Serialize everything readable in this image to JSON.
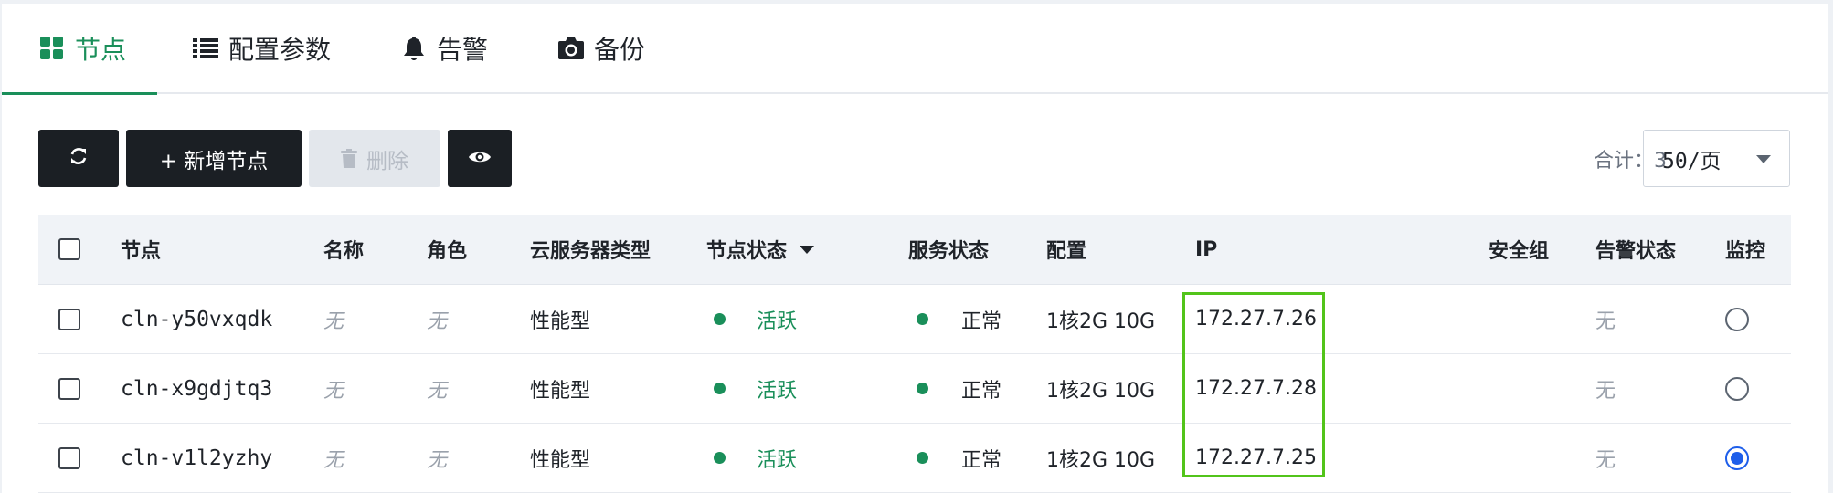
{
  "tabs": [
    {
      "label": "节点",
      "icon": "grid-icon",
      "active": true
    },
    {
      "label": "配置参数",
      "icon": "list-icon",
      "active": false
    },
    {
      "label": "告警",
      "icon": "bell-icon",
      "active": false
    },
    {
      "label": "备份",
      "icon": "camera-icon",
      "active": false
    }
  ],
  "toolbar": {
    "refresh_icon": "refresh-icon",
    "add_label": "+ 新增节点",
    "delete_label": "删除",
    "delete_icon": "trash-icon",
    "view_icon": "eye-icon",
    "total_label": "合计：3",
    "page_size": "50/页"
  },
  "table": {
    "columns": [
      "节点",
      "名称",
      "角色",
      "云服务器类型",
      "节点状态",
      "服务状态",
      "配置",
      "IP",
      "安全组",
      "告警状态",
      "监控"
    ],
    "rows": [
      {
        "node": "cln-y50vxqdk",
        "name": "无",
        "role": "无",
        "type": "性能型",
        "node_status": "活跃",
        "service_status": "正常",
        "config": "1核2G 10G",
        "ip": "172.27.7.26",
        "security_group": "",
        "alarm": "无",
        "monitor_selected": false
      },
      {
        "node": "cln-x9gdjtq3",
        "name": "无",
        "role": "无",
        "type": "性能型",
        "node_status": "活跃",
        "service_status": "正常",
        "config": "1核2G 10G",
        "ip": "172.27.7.28",
        "security_group": "",
        "alarm": "无",
        "monitor_selected": false
      },
      {
        "node": "cln-v1l2yzhy",
        "name": "无",
        "role": "无",
        "type": "性能型",
        "node_status": "活跃",
        "service_status": "正常",
        "config": "1核2G 10G",
        "ip": "172.27.7.25",
        "security_group": "",
        "alarm": "无",
        "monitor_selected": true
      }
    ]
  },
  "colors": {
    "accent": "#1a8f5a",
    "dark_button": "#1b1f24",
    "highlight": "#52c41a",
    "radio_selected": "#1e5eea"
  }
}
